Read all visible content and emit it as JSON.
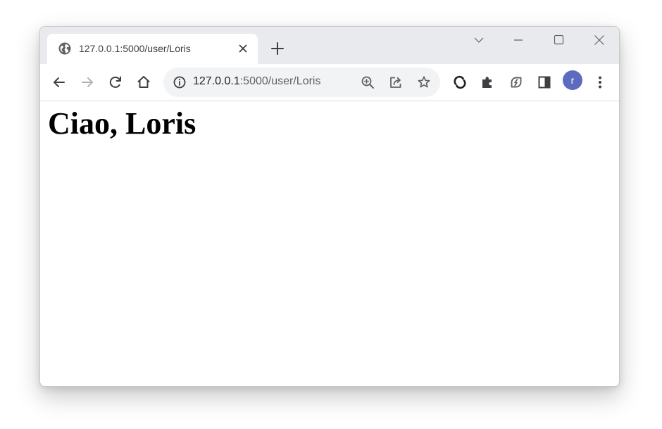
{
  "browser": {
    "tab": {
      "title": "127.0.0.1:5000/user/Loris",
      "favicon": "globe-icon"
    },
    "new_tab_icon": "plus-icon",
    "window_controls": [
      "tab-search-chevron-icon",
      "minimize-icon",
      "maximize-icon",
      "close-window-icon"
    ],
    "toolbar": {
      "back_icon": "arrow-left-icon",
      "forward_icon": "arrow-right-icon",
      "reload_icon": "reload-icon",
      "home_icon": "home-icon",
      "address": {
        "host": "127.0.0.1",
        "path": ":5000/user/Loris",
        "site_info_icon": "info-icon"
      },
      "omnibox_actions": [
        "zoom-in-icon",
        "share-icon",
        "bookmark-star-icon"
      ],
      "extensions": [
        "sync-icon",
        "extensions-puzzle-icon",
        "performance-leaf-icon",
        "side-panel-icon"
      ],
      "profile_initial": "r",
      "menu_icon": "kebab-menu-icon"
    }
  },
  "page": {
    "heading": "Ciao, Loris"
  },
  "colors": {
    "tabstrip_bg": "#e8eaed",
    "omnibox_bg": "#f1f3f4",
    "avatar_bg": "#5c6bc0",
    "icon_gray": "#5f6368"
  }
}
